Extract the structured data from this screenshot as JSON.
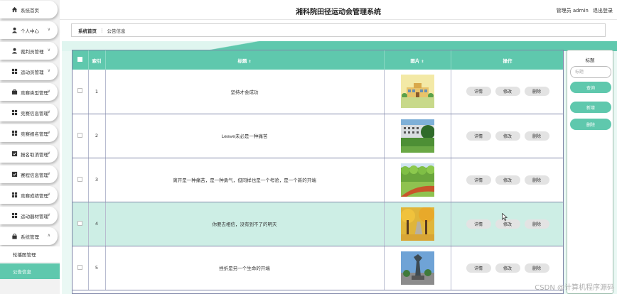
{
  "app": {
    "title": "湘科院田径运动会管理系统",
    "user_label": "管理员 admin",
    "logout": "退出登录"
  },
  "sidebar": {
    "items": [
      {
        "label": "系统首页",
        "icon": "home-icon"
      },
      {
        "label": "个人中心",
        "icon": "person-icon"
      },
      {
        "label": "裁判员管理",
        "icon": "person-icon"
      },
      {
        "label": "运动员管理",
        "icon": "grid-icon"
      },
      {
        "label": "竞赛类型管理",
        "icon": "briefcase-icon"
      },
      {
        "label": "竞赛信息管理",
        "icon": "grid-icon"
      },
      {
        "label": "竞赛报名管理",
        "icon": "grid-icon"
      },
      {
        "label": "报名取消管理",
        "icon": "checkbox-icon"
      },
      {
        "label": "赛程信息管理",
        "icon": "checkbox-icon"
      },
      {
        "label": "竞赛成绩管理",
        "icon": "grid-icon"
      },
      {
        "label": "运动器材管理",
        "icon": "grid-icon"
      },
      {
        "label": "系统管理",
        "icon": "lock-icon"
      }
    ],
    "subitems": [
      {
        "label": "轮播图管理"
      },
      {
        "label": "公告信息"
      }
    ]
  },
  "breadcrumb": {
    "home": "系统首页",
    "separator": "⋮",
    "current": "公告信息"
  },
  "table": {
    "headers": {
      "index": "索引",
      "title": "标题",
      "image": "图片",
      "actions": "操作"
    },
    "rows": [
      {
        "index": "1",
        "title": "坚持才会成功",
        "image": "building-thumb"
      },
      {
        "index": "2",
        "title": "Leave未必是一种痛苦",
        "image": "campus-thumb"
      },
      {
        "index": "3",
        "title": "离开是一种痛苦，是一种勇气，但同样也是一个考验，是一个新的开端",
        "image": "track-thumb"
      },
      {
        "index": "4",
        "title": "你要去相信，没有到不了的明天",
        "image": "autumn-thumb"
      },
      {
        "index": "5",
        "title": "挫折是另一个生命的开端",
        "image": "sculpture-thumb"
      }
    ],
    "buttons": {
      "detail": "详情",
      "edit": "修改",
      "delete": "删除"
    }
  },
  "right_panel": {
    "title": "标题",
    "placeholder": "标题",
    "query": "查询",
    "add": "新增",
    "delete": "删除"
  },
  "watermark": "CSDN @计算机程序源码",
  "colors": {
    "accent": "#5fc8ad",
    "highlight_row": "#cdeee5"
  }
}
